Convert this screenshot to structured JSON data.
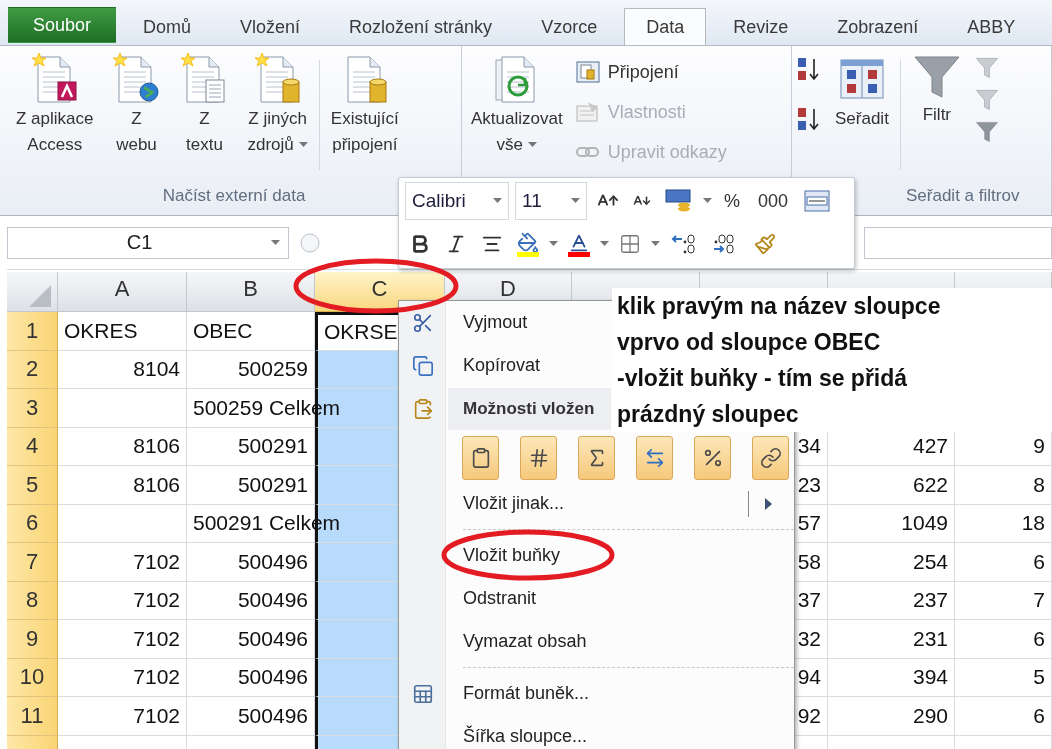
{
  "tabs": [
    {
      "label": "Soubor",
      "kind": "file",
      "selected": false
    },
    {
      "label": "Domů",
      "kind": "tab",
      "selected": false
    },
    {
      "label": "Vložení",
      "kind": "tab",
      "selected": false
    },
    {
      "label": "Rozložení stránky",
      "kind": "tab",
      "selected": false
    },
    {
      "label": "Vzorce",
      "kind": "tab",
      "selected": false
    },
    {
      "label": "Data",
      "kind": "tab",
      "selected": true
    },
    {
      "label": "Revize",
      "kind": "tab",
      "selected": false
    },
    {
      "label": "Zobrazení",
      "kind": "tab",
      "selected": false
    },
    {
      "label": "ABBY",
      "kind": "tab",
      "selected": false
    }
  ],
  "ribbon": {
    "external_data": {
      "label": "Načíst externí data",
      "buttons": [
        {
          "lines": [
            "Z aplikace",
            "Access"
          ],
          "dropdown": false
        },
        {
          "lines": [
            "Z",
            "webu"
          ],
          "dropdown": false
        },
        {
          "lines": [
            "Z",
            "textu"
          ],
          "dropdown": false
        },
        {
          "lines": [
            "Z jiných",
            "zdrojů"
          ],
          "dropdown": true
        },
        {
          "lines": [
            "Existující",
            "připojení"
          ],
          "dropdown": false
        }
      ]
    },
    "connections": {
      "refresh": {
        "lines": [
          "Aktualizovat",
          "vše"
        ],
        "dropdown": true
      },
      "items": [
        {
          "label": "Připojení",
          "disabled": false
        },
        {
          "label": "Vlastnosti",
          "disabled": true
        },
        {
          "label": "Upravit odkazy",
          "disabled": true
        }
      ]
    },
    "sort_filter": {
      "label": "Seřadit a filtrov",
      "sort": "Seřadit",
      "filter": "Filtr"
    }
  },
  "name_box": {
    "value": "C1"
  },
  "mini_toolbar": {
    "font": "Calibri",
    "size": "11",
    "percent": "%",
    "thousands": "000"
  },
  "grid": {
    "columns": [
      {
        "label": "A",
        "selected": false,
        "circled": false
      },
      {
        "label": "B",
        "selected": false,
        "circled": false
      },
      {
        "label": "C",
        "selected": true,
        "circled": true
      },
      {
        "label": "D",
        "selected": false,
        "circled": false
      }
    ],
    "rows": [
      {
        "header": "1",
        "cells": {
          "a": "OKRES",
          "b": "OBEC",
          "c": "OKRSE"
        }
      },
      {
        "header": "2",
        "cells": {
          "a": "8104",
          "b": "500259"
        }
      },
      {
        "header": "3",
        "cells": {
          "b": "500259 Celkem"
        }
      },
      {
        "header": "4",
        "cells": {
          "a": "8106",
          "b": "500291",
          "f": "34",
          "g": "427",
          "h": "9"
        }
      },
      {
        "header": "5",
        "cells": {
          "a": "8106",
          "b": "500291",
          "f": "23",
          "g": "622",
          "h": "8"
        }
      },
      {
        "header": "6",
        "cells": {
          "b": "500291 Celkem",
          "f": "57",
          "g": "1049",
          "h": "18"
        }
      },
      {
        "header": "7",
        "cells": {
          "a": "7102",
          "b": "500496",
          "f": "58",
          "g": "254",
          "h": "6"
        }
      },
      {
        "header": "8",
        "cells": {
          "a": "7102",
          "b": "500496",
          "f": "37",
          "g": "237",
          "h": "7"
        }
      },
      {
        "header": "9",
        "cells": {
          "a": "7102",
          "b": "500496",
          "f": "32",
          "g": "231",
          "h": "6"
        }
      },
      {
        "header": "10",
        "cells": {
          "a": "7102",
          "b": "500496",
          "f": "94",
          "g": "394",
          "h": "5"
        }
      },
      {
        "header": "11",
        "cells": {
          "a": "7102",
          "b": "500496",
          "f": "92",
          "g": "290",
          "h": "6"
        }
      }
    ]
  },
  "context_menu": {
    "items": [
      {
        "kind": "item",
        "label": "Vyjmout",
        "circled": false
      },
      {
        "kind": "item",
        "label": "Kopírovat",
        "circled": false
      },
      {
        "kind": "header",
        "label": "Možnosti vložen"
      },
      {
        "kind": "paste_options"
      },
      {
        "kind": "submenu",
        "label": "Vložit jinak...",
        "circled": false
      },
      {
        "kind": "separator"
      },
      {
        "kind": "item",
        "label": "Vložit buňky",
        "circled": true
      },
      {
        "kind": "item",
        "label": "Odstranit",
        "circled": false
      },
      {
        "kind": "item",
        "label": "Vymazat obsah",
        "circled": false
      },
      {
        "kind": "separator"
      },
      {
        "kind": "item",
        "label": "Formát buněk...",
        "circled": false
      },
      {
        "kind": "item",
        "label": "Šířka sloupce...",
        "circled": false
      }
    ]
  },
  "annotation": {
    "lines": [
      "klik pravým na název sloupce",
      "vprvo od sloupce OBEC",
      "-vložit buňky - tím se přidá",
      "prázdný sloupec"
    ]
  }
}
